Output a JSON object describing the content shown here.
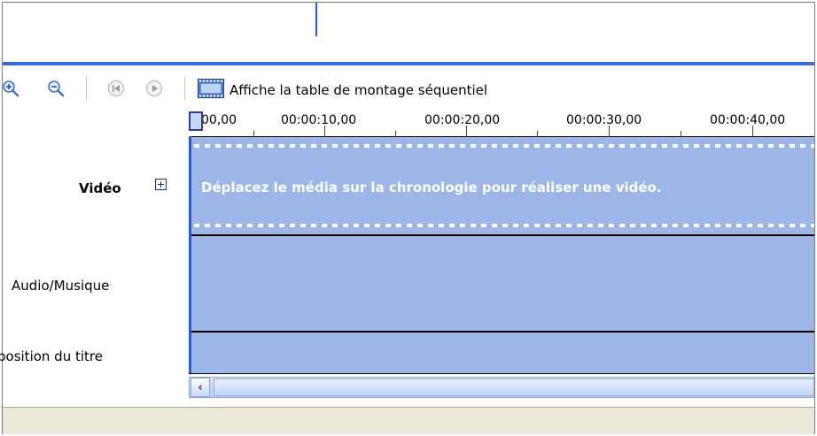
{
  "toolbar": {
    "zoom_in_icon": "zoom-in-icon",
    "zoom_out_icon": "zoom-out-icon",
    "rewind_icon": "rewind-icon",
    "play_icon": "play-icon",
    "storyboard_icon": "film-strip-icon",
    "storyboard_label": "Affiche la table de montage séquentiel"
  },
  "ruler": {
    "ticks": [
      "00,00",
      "00:00:10,00",
      "00:00:20,00",
      "00:00:30,00",
      "00:00:40,00"
    ]
  },
  "tracks": {
    "video": {
      "label": "Vidéo",
      "message": "Déplacez le média sur la chronologie pour réaliser une vidéo."
    },
    "audio": {
      "label": "Audio/Musique"
    },
    "title": {
      "label": "position du titre"
    }
  },
  "colors": {
    "track_fill": "#9db6e8",
    "accent_blue": "#3a6cd9",
    "status_bar": "#ece9d8"
  }
}
